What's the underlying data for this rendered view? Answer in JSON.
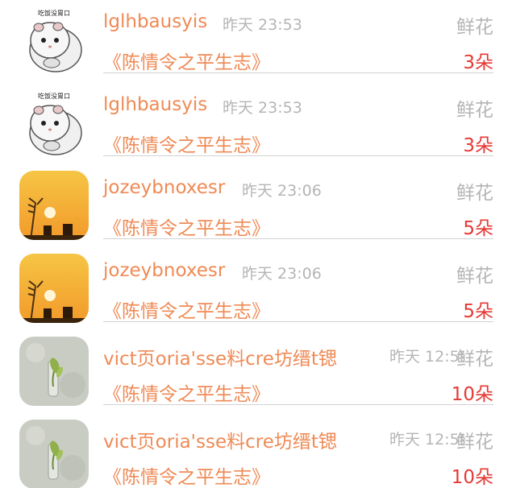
{
  "records": [
    {
      "name": "lglhbausyis",
      "time": "昨天 23:53",
      "gift": "鲜花",
      "book": "《陈情令之平生志》",
      "count": "3朵",
      "avatar": "hamster-avatar",
      "avatar_caption": "吃饭没胃口"
    },
    {
      "name": "lglhbausyis",
      "time": "昨天 23:53",
      "gift": "鲜花",
      "book": "《陈情令之平生志》",
      "count": "3朵",
      "avatar": "hamster-avatar",
      "avatar_caption": "吃饭没胃口"
    },
    {
      "name": "jozeybnoxesr",
      "time": "昨天 23:06",
      "gift": "鲜花",
      "book": "《陈情令之平生志》",
      "count": "5朵",
      "avatar": "sunset-avatar"
    },
    {
      "name": "jozeybnoxesr",
      "time": "昨天 23:06",
      "gift": "鲜花",
      "book": "《陈情令之平生志》",
      "count": "5朵",
      "avatar": "sunset-avatar"
    },
    {
      "name": "vict页oria'sse料cre坊缙t锶",
      "time": "昨天 12:59",
      "gift": "鲜花",
      "book": "《陈情令之平生志》",
      "count": "10朵",
      "avatar": "sprout-avatar"
    },
    {
      "name": "vict页oria'sse料cre坊缙t锶",
      "time": "昨天 12:59",
      "gift": "鲜花",
      "book": "《陈情令之平生志》",
      "count": "10朵",
      "avatar": "sprout-avatar"
    }
  ],
  "colors": {
    "name": "#ef8a55",
    "meta": "#b5b5b5",
    "count": "#e53935",
    "divider": "#d2d2d2"
  }
}
